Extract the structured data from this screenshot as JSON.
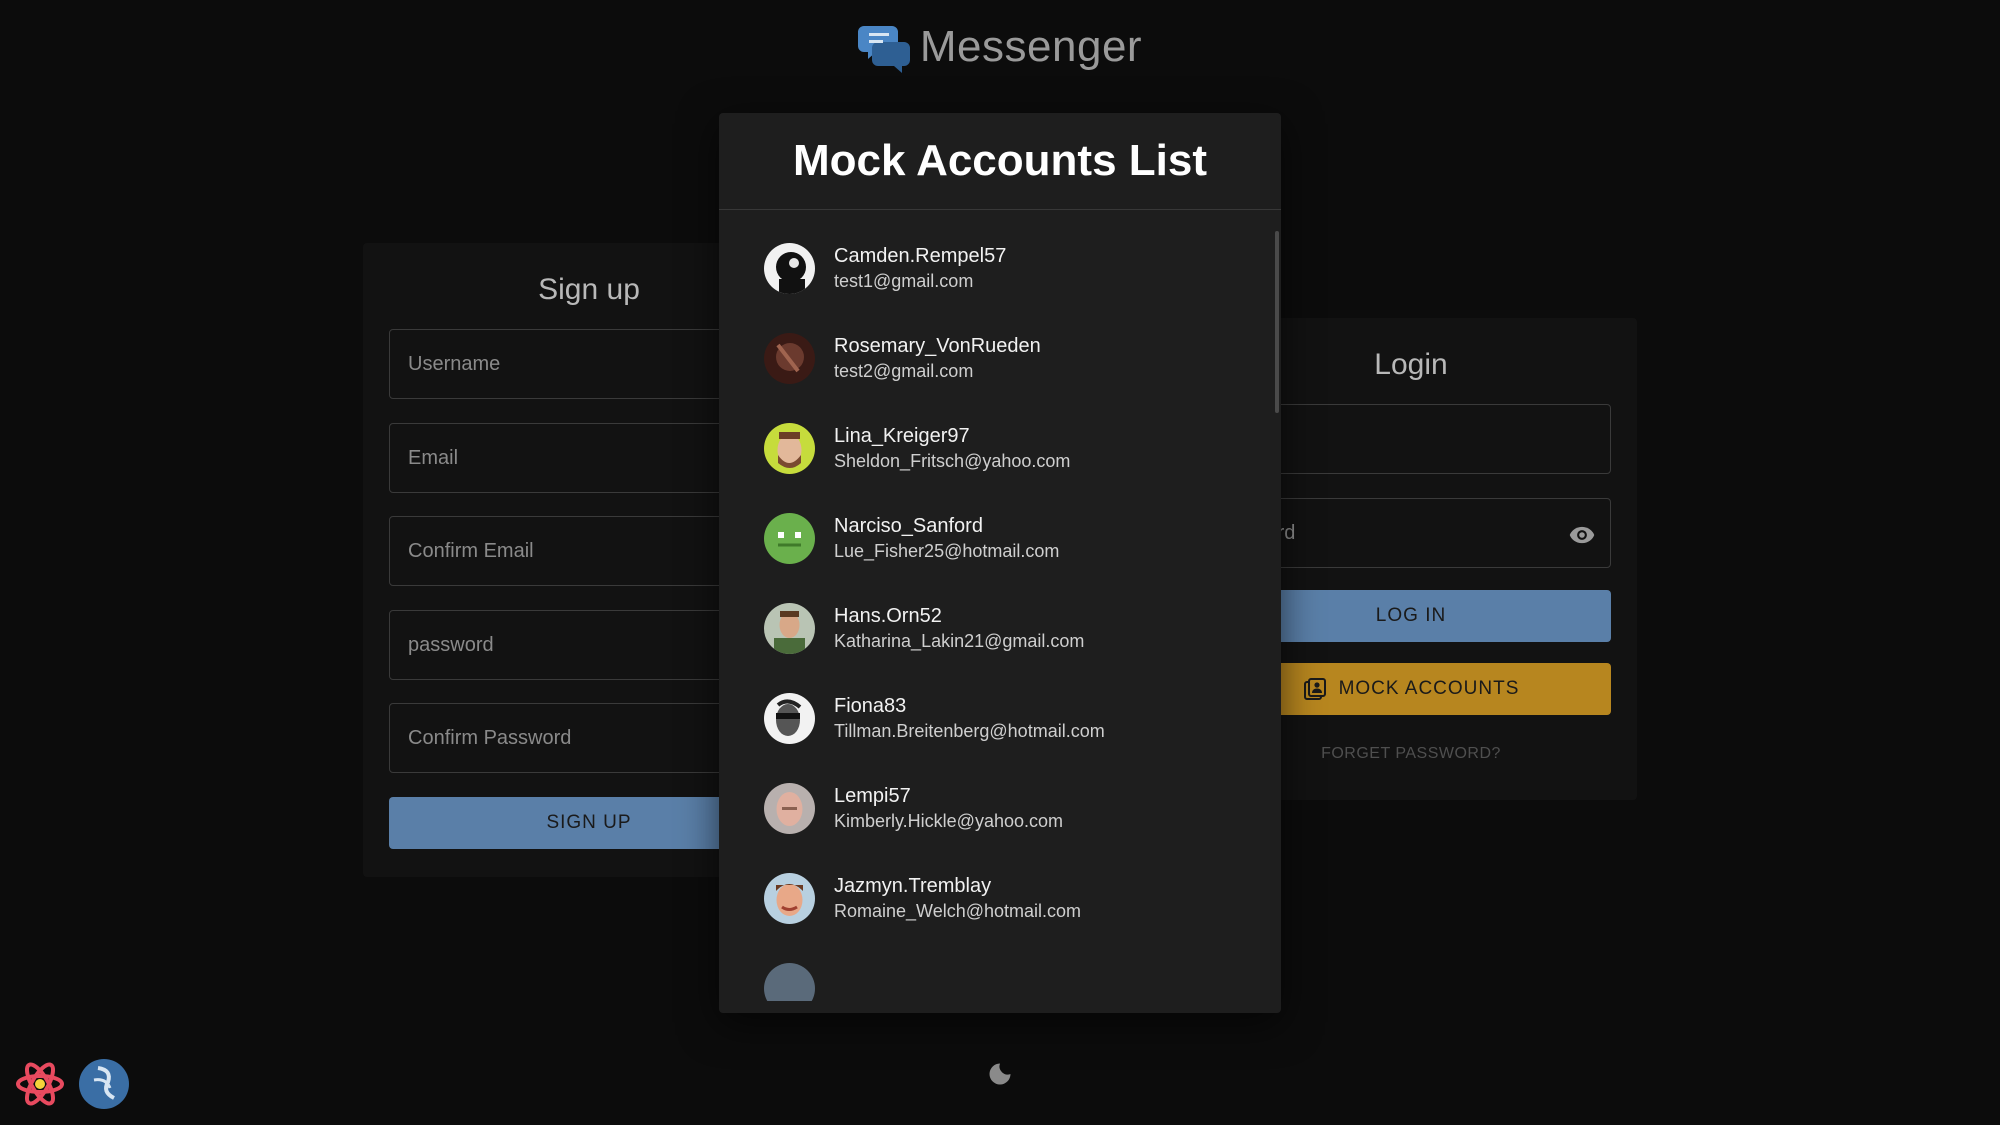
{
  "app": {
    "title": "Messenger"
  },
  "signup": {
    "title": "Sign up",
    "fields": [
      {
        "placeholder": "Username"
      },
      {
        "placeholder": "Email"
      },
      {
        "placeholder": "Confirm Email"
      },
      {
        "placeholder": "password"
      },
      {
        "placeholder": "Confirm Password"
      }
    ],
    "button_label": "SIGN UP"
  },
  "login": {
    "title": "Login",
    "password_placeholder_visible": "word",
    "login_button": "LOG IN",
    "mock_button": "MOCK ACCOUNTS",
    "forgot_link": "FORGET PASSWORD?"
  },
  "modal": {
    "title": "Mock Accounts List",
    "accounts": [
      {
        "name": "Camden.Rempel57",
        "email": "test1@gmail.com",
        "avatar_color": "#111111"
      },
      {
        "name": "Rosemary_VonRueden",
        "email": "test2@gmail.com",
        "avatar_color": "#5a2a22"
      },
      {
        "name": "Lina_Kreiger97",
        "email": "Sheldon_Fritsch@yahoo.com",
        "avatar_color": "#b9d13a"
      },
      {
        "name": "Narciso_Sanford",
        "email": "Lue_Fisher25@hotmail.com",
        "avatar_color": "#6ab04c"
      },
      {
        "name": "Hans.Orn52",
        "email": "Katharina_Lakin21@gmail.com",
        "avatar_color": "#7a8c6a"
      },
      {
        "name": "Fiona83",
        "email": "Tillman.Breitenberg@hotmail.com",
        "avatar_color": "#e8e8e8"
      },
      {
        "name": "Lempi57",
        "email": "Kimberly.Hickle@yahoo.com",
        "avatar_color": "#b89a8a"
      },
      {
        "name": "Jazmyn.Tremblay",
        "email": "Romaine_Welch@hotmail.com",
        "avatar_color": "#c46a4a"
      }
    ]
  },
  "colors": {
    "background": "#0c0c0c",
    "modal": "#1e1e1e",
    "primary_button": "#5a7fa8",
    "mock_button": "#b7861f",
    "logo": "#3a6ea5"
  },
  "icons": [
    "messenger-logo-icon",
    "eye-icon",
    "contacts-icon",
    "moon-icon",
    "react-devtools-icon",
    "redux-devtools-icon"
  ]
}
